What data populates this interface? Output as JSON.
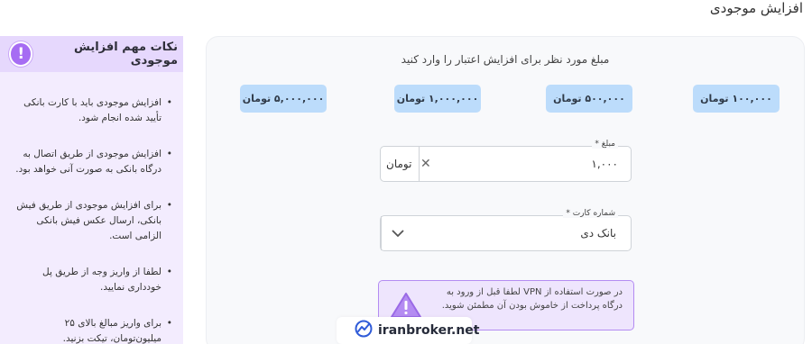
{
  "page": {
    "title": "افزایش موجودی"
  },
  "sidebar": {
    "title": "نکات مهم افزایش موجودی",
    "icon": "info-icon",
    "tips": [
      "افزایش موجودی باید با کارت بانکی تأیید شده انجام شود.",
      "افزایش موجودی از طریق اتصال به درگاه بانکی به صورت آنی خواهد بود.",
      "برای افزایش موجودی از طریق فیش بانکی، ارسال عکس فیش بانکی الزامی است.",
      "لطفا از واریز وجه از طریق پل خودداری نمایید.",
      "برای واریز مبالغ بالای ۲۵ میلیون‌تومان، تیکت بزنید."
    ]
  },
  "main": {
    "heading": "مبلغ مورد نظر برای افزایش اعتبار را وارد کنید",
    "amount_options": [
      "۱۰۰,۰۰۰ تومان",
      "۵۰۰,۰۰۰ تومان",
      "۱,۰۰۰,۰۰۰ تومان",
      "۵,۰۰۰,۰۰۰ تومان"
    ],
    "amount_field": {
      "label": "مبلغ *",
      "value": "۱,۰۰۰",
      "unit": "تومان"
    },
    "card_field": {
      "label": "شماره کارت *",
      "value": "بانک دی"
    },
    "warning": {
      "text": "در صورت استفاده از VPN لطفا قبل از ورود به درگاه پرداخت از خاموش بودن آن مطمئن شوید."
    }
  },
  "watermark": {
    "text": "iranbroker.net"
  },
  "colors": {
    "accent": "#a66cf3",
    "chip": "#bcdcfb",
    "sidebar_bg": "#f3ecfe",
    "warning_border": "#b48cf2"
  }
}
